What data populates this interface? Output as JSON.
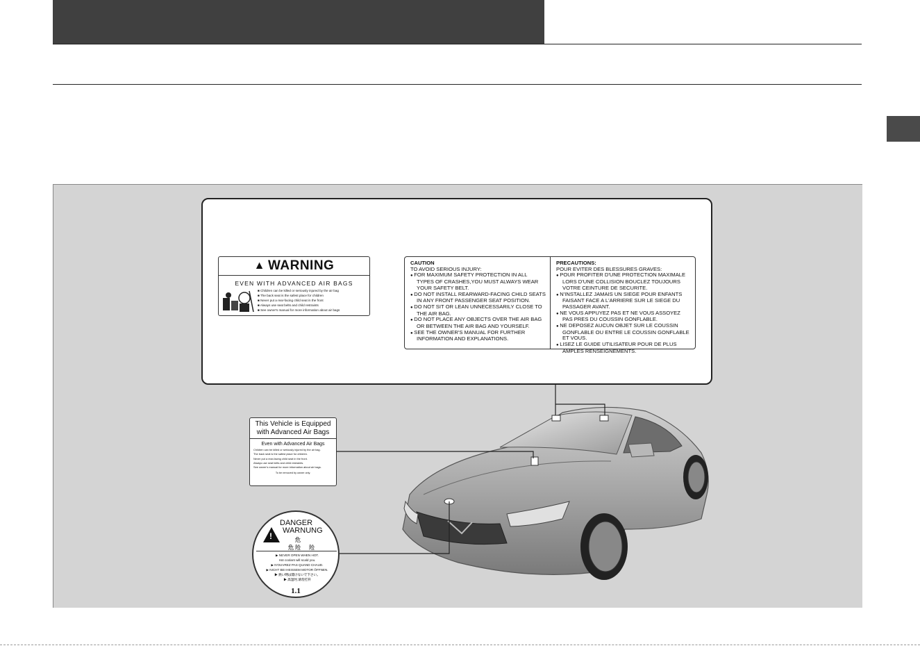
{
  "warning_label": {
    "heading": "WARNING",
    "subheading": "EVEN WITH ADVANCED AIR BAGS",
    "items": [
      "Children can be killed or seriously injured by the air bag",
      "The back seat is the safest place for children",
      "Never put a rear-facing child seat in the front",
      "Always use seat belts and child restraints",
      "See owner's manual for more information about air bags"
    ]
  },
  "caution_label": {
    "english_title": "CAUTION",
    "english_intro": "TO AVOID SERIOUS INJURY:",
    "english_items": [
      "FOR MAXIMUM SAFETY PROTECTION IN ALL TYPES OF CRASHES,YOU MUST ALWAYS WEAR YOUR SAFETY BELT.",
      "DO NOT INSTALL REARWARD-FACING CHILD SEATS IN ANY FRONT PASSENGER SEAT POSITION.",
      "DO NOT SIT OR LEAN UNNECESSARILY CLOSE TO THE AIR BAG.",
      "DO NOT PLACE ANY OBJECTS OVER THE AIR BAG OR BETWEEN THE AIR BAG AND YOURSELF.",
      "SEE THE OWNER'S MANUAL FOR FURTHER INFORMATION AND EXPLANATIONS."
    ],
    "french_title": "PRECAUTIONS:",
    "french_intro": "POUR EVITER DES BLESSURES GRAVES:",
    "french_items": [
      "POUR PROFITER D'UNE PROTECTION MAXIMALE LORS D'UNE COLLISION BOUCLEZ TOUJOURS VOTRE CEINTURE DE SECURITE.",
      "N'INSTALLEZ JAMAIS UN SIEGE POUR ENFANTS FAISANT FACE A L'ARRIERE SUR LE SIEGE DU PASSAGER AVANT.",
      "NE VOUS APPUYEZ PAS ET NE VOUS ASSOYEZ PAS PRES DU COUSSIN GONFLABLE.",
      "NE DEPOSEZ AUCUN OBJET SUR LE COUSSIN GONFLABLE OU ENTRE LE COUSSIN GONFLABLE ET VOUS.",
      "LISEZ LE GUIDE UTILISATEUR POUR DE PLUS AMPLES RENSEIGNEMENTS."
    ]
  },
  "hood_label": {
    "title": "This Vehicle is Equipped with Advanced Air Bags",
    "subtitle": "Even with Advanced Air Bags",
    "lines": [
      "Children can be killed or seriously injured by the air bag.",
      "The back seat is the safest place for children.",
      "Never put a rear-facing child seat in the front.",
      "Always use seat belts and child restraints.",
      "See owner's manual for more information about air bags."
    ],
    "footer": "To be removed by owner only."
  },
  "cap_label": {
    "danger": "DANGER",
    "warnung": "WARNUNG",
    "kanji_1": "危险",
    "kanji_2": "危险",
    "lines": [
      "▶ NEVER OPEN WHEN HOT.",
      "Hot coolant will scald you.",
      "▶ N'OUVREZ PAS QUAND CHAUD.",
      "▶ NICHT BEI HEISSEM MOTOR ÖFFNEN.",
      "▶ 熱い時は開けないで下さい。",
      "▶ 高温时,请勿打开"
    ],
    "number": "1.1"
  }
}
